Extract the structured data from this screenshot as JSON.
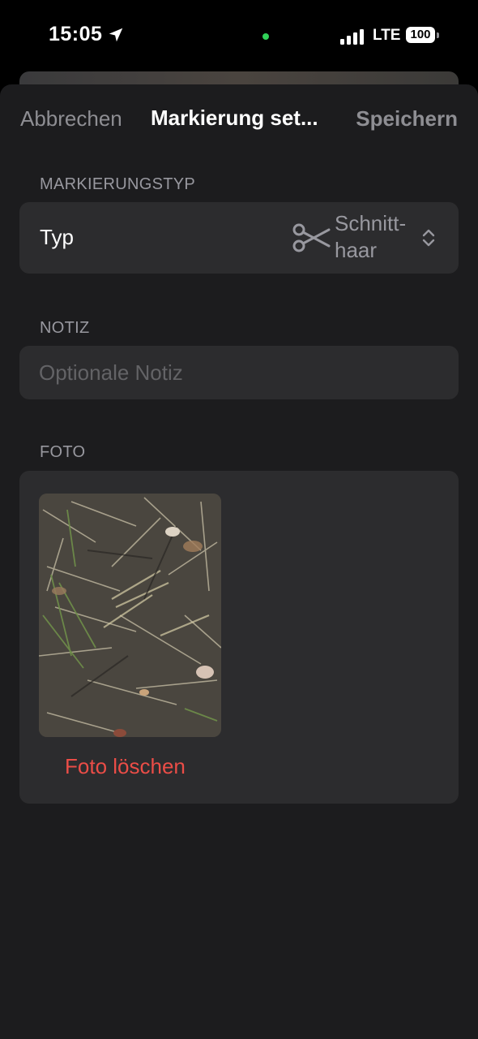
{
  "status_bar": {
    "time": "15:05",
    "network": "LTE",
    "battery": "100",
    "icons": [
      "location-arrow-icon",
      "cellular-signal-icon",
      "battery-icon"
    ]
  },
  "nav": {
    "cancel_label": "Abbrechen",
    "title": "Markierung set...",
    "save_label": "Speichern"
  },
  "marker_type_section": {
    "header": "MARKIERUNGSTYP",
    "row_label": "Typ",
    "value": "Schnitt-­haar",
    "value_lines": [
      "Schnitt-",
      "haar"
    ],
    "icon": "scissors-icon"
  },
  "note_section": {
    "header": "NOTIZ",
    "placeholder": "Optionale Notiz",
    "value": ""
  },
  "photo_section": {
    "header": "FOTO",
    "delete_label": "Foto löschen"
  },
  "colors": {
    "background": "#1c1c1e",
    "group": "#2c2c2e",
    "secondary_text": "#98989f",
    "destructive": "#eb4d47",
    "status_dot": "#30d158"
  }
}
